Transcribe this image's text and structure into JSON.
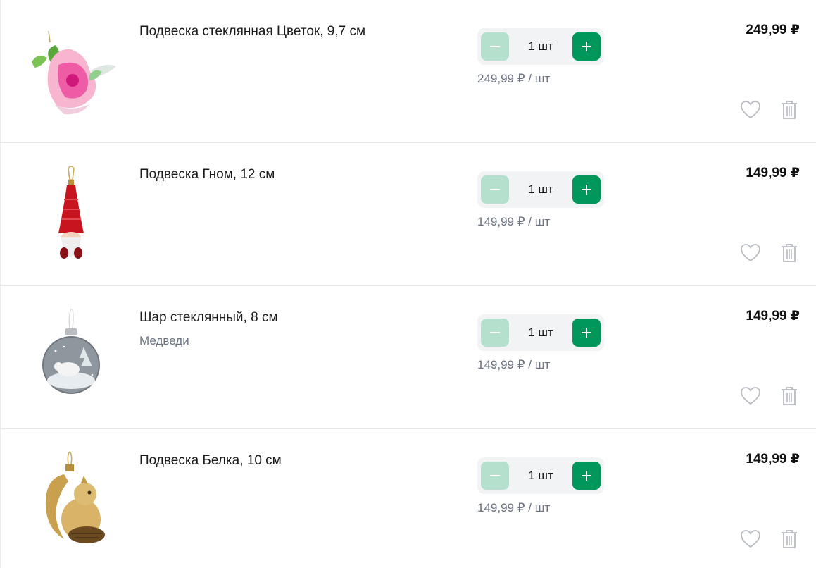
{
  "cart": {
    "items": [
      {
        "name": "Подвеска стеклянная Цветок, 9,7 см",
        "variant": "",
        "image_icon": "flower-ornament-image",
        "quantity": "1 шт",
        "unit_price": "249,99 ₽ / шт",
        "total_price": "249,99 ₽"
      },
      {
        "name": "Подвеска Гном, 12 см",
        "variant": "",
        "image_icon": "gnome-ornament-image",
        "quantity": "1 шт",
        "unit_price": "149,99 ₽ / шт",
        "total_price": "149,99 ₽"
      },
      {
        "name": "Шар стеклянный, 8 см",
        "variant": "Медведи",
        "image_icon": "glass-ball-bears-image",
        "quantity": "1 шт",
        "unit_price": "149,99 ₽ / шт",
        "total_price": "149,99 ₽"
      },
      {
        "name": "Подвеска Белка, 10 см",
        "variant": "",
        "image_icon": "squirrel-ornament-image",
        "quantity": "1 шт",
        "unit_price": "149,99 ₽ / шт",
        "total_price": "149,99 ₽"
      }
    ],
    "icons": {
      "minus": "minus-icon",
      "plus": "plus-icon",
      "favorite": "heart-icon",
      "delete": "trash-icon"
    },
    "colors": {
      "accent": "#00985a",
      "accent_light": "#b4e0cd",
      "muted_text": "#6b7280",
      "divider": "#e6e8ea"
    }
  }
}
